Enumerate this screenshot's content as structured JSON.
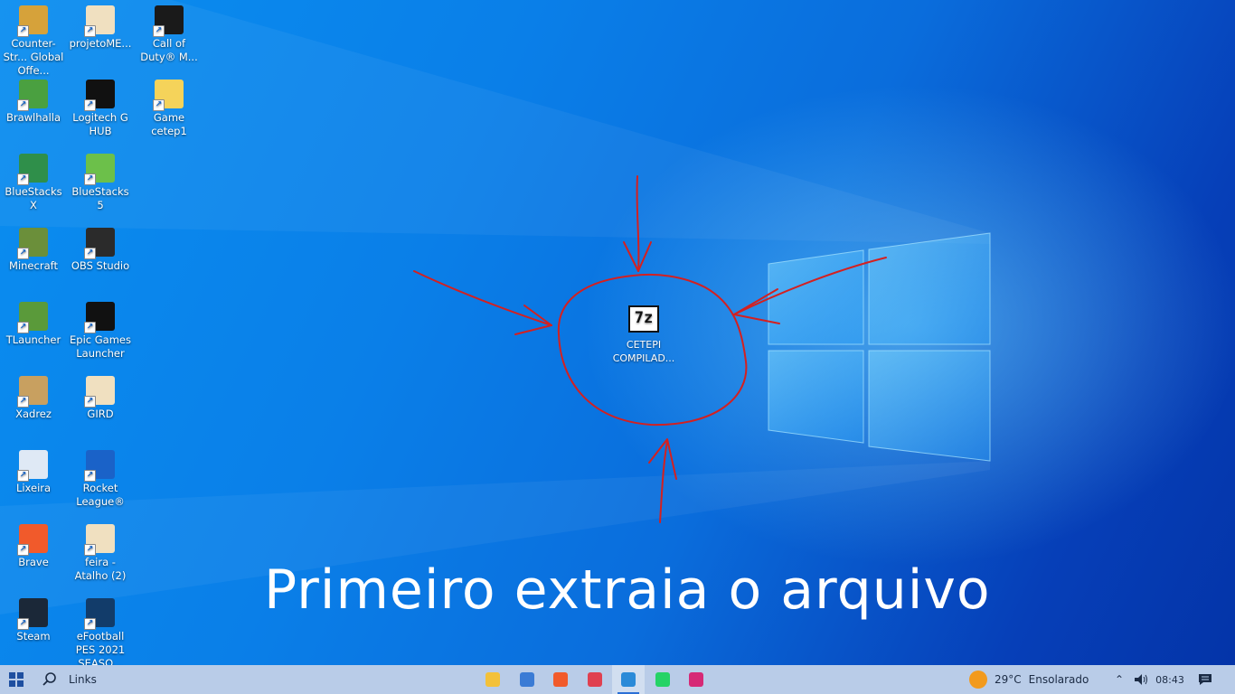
{
  "desktop": {
    "icons": [
      {
        "label": "Counter-Str... Global Offe...",
        "icon": "csgo-icon",
        "color": "#d6a23a"
      },
      {
        "label": "projetoME...",
        "icon": "document-icon",
        "color": "#f0e0c0"
      },
      {
        "label": "Call of Duty® M...",
        "icon": "cod-icon",
        "color": "#1a1a1a"
      },
      {
        "label": "Brawlhalla",
        "icon": "brawlhalla-icon",
        "color": "#4aa040"
      },
      {
        "label": "Logitech G HUB",
        "icon": "logitech-icon",
        "color": "#111111"
      },
      {
        "label": "Game cetep1",
        "icon": "folder-icon",
        "color": "#f5d35a"
      },
      {
        "label": "BlueStacks X",
        "icon": "bluestacks-x-icon",
        "color": "#2f8f4a"
      },
      {
        "label": "BlueStacks 5",
        "icon": "bluestacks-icon",
        "color": "#6cc04a"
      },
      {
        "label": "Minecraft",
        "icon": "minecraft-icon",
        "color": "#6b8f3a"
      },
      {
        "label": "OBS Studio",
        "icon": "obs-icon",
        "color": "#2b2b2b"
      },
      {
        "label": "TLauncher",
        "icon": "tlauncher-icon",
        "color": "#5a9a3a"
      },
      {
        "label": "Epic Games Launcher",
        "icon": "epic-icon",
        "color": "#111111"
      },
      {
        "label": "Xadrez",
        "icon": "chess-icon",
        "color": "#c8a060"
      },
      {
        "label": "GIRD",
        "icon": "document-icon",
        "color": "#f0e0c0"
      },
      {
        "label": "Lixeira",
        "icon": "recycle-bin-icon",
        "color": "#dfe9f5"
      },
      {
        "label": "Rocket League®",
        "icon": "rocket-league-icon",
        "color": "#1a62c8"
      },
      {
        "label": "Brave",
        "icon": "brave-icon",
        "color": "#f15a2b"
      },
      {
        "label": "feira - Atalho (2)",
        "icon": "document-icon",
        "color": "#f0e0c0"
      },
      {
        "label": "Steam",
        "icon": "steam-icon",
        "color": "#1b2838"
      },
      {
        "label": "eFootball PES 2021 SEASO...",
        "icon": "efootball-icon",
        "color": "#123c6a"
      }
    ],
    "center_file": {
      "label": "CETEPI COMPILAD...",
      "icon": "7zip-icon",
      "glyph": "7z"
    },
    "banner": "Primeiro extraia o arquivo",
    "annotation_color": "#d42020"
  },
  "taskbar": {
    "search_label": "Links",
    "apps": [
      {
        "name": "file-explorer",
        "color": "#f3c13a"
      },
      {
        "name": "microsoft-store",
        "color": "#3a7bd5"
      },
      {
        "name": "brave",
        "color": "#f15a2b"
      },
      {
        "name": "app-pinned",
        "color": "#e04050"
      },
      {
        "name": "vscode",
        "color": "#2a8ad8",
        "active": true
      },
      {
        "name": "whatsapp",
        "color": "#25d366"
      },
      {
        "name": "instagram",
        "color": "#d62976"
      }
    ],
    "weather": {
      "temp": "29°C",
      "condition": "Ensolarado"
    },
    "time": "08:43"
  }
}
